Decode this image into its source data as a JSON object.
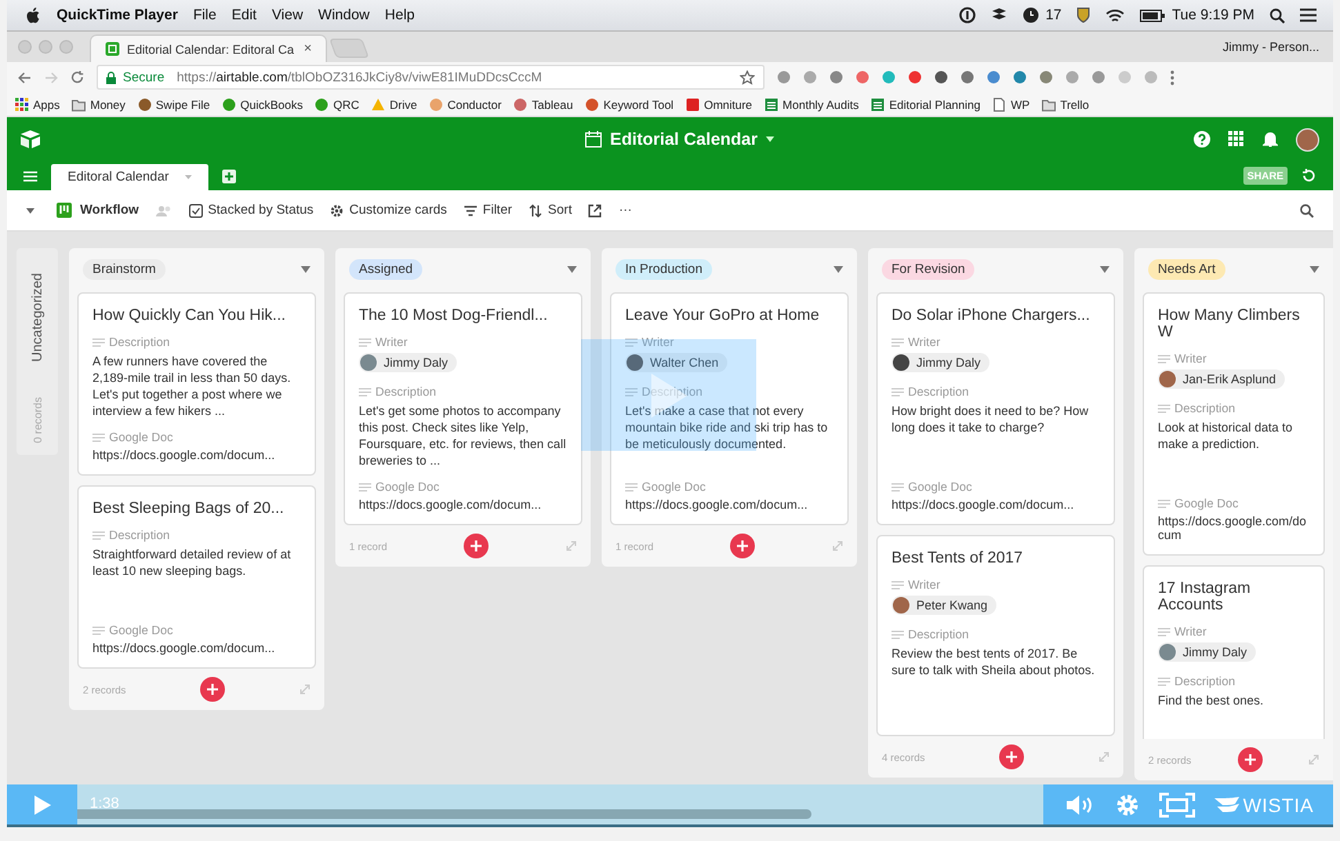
{
  "menubar": {
    "app": "QuickTime Player",
    "menus": [
      "File",
      "Edit",
      "View",
      "Window",
      "Help"
    ],
    "badge": "17",
    "clock": "Tue 9:19 PM"
  },
  "browser": {
    "tab": {
      "title": "Editorial Calendar: Editoral Ca",
      "close": "×"
    },
    "profile": "Jimmy - Person...",
    "secure": "Secure",
    "url": "https://**airtable.com**/tblObOZ316JkCiy8v/viwE81IMuDDcsCccM",
    "bookmarks": [
      "Apps",
      "Money",
      "Swipe File",
      "QuickBooks",
      "QRC",
      "Drive",
      "Conductor",
      "Tableau",
      "Keyword Tool",
      "Omniture",
      "Monthly Audits",
      "Editorial Planning",
      "WP",
      "Trello"
    ]
  },
  "app": {
    "base_title": "Editorial Calendar",
    "tabs": [
      {
        "label": "Editoral Calendar",
        "selected": true
      }
    ],
    "share": "SHARE",
    "view": "Workflow",
    "toolbar": [
      "Stacked by Status",
      "Customize cards",
      "Filter",
      "Sort"
    ],
    "more": "···"
  },
  "uncategorized": {
    "label": "Uncategorized",
    "count": "0 records"
  },
  "columns": [
    {
      "name": "Brainstorm",
      "color": "#ebebeb",
      "count": "2 records",
      "cards": [
        {
          "title": "How Quickly Can You Hik...",
          "fields": [
            {
              "kind": "text",
              "label": "Description",
              "value": "A few runners have covered the 2,189-mile trail in less than 50 days. Let's put together a post where we interview a few hikers ..."
            },
            {
              "kind": "url",
              "label": "Google Doc",
              "value": "https://docs.google.com/docum..."
            }
          ]
        },
        {
          "title": "Best Sleeping Bags of 20...",
          "fields": [
            {
              "kind": "text",
              "label": "Description",
              "value": "Straightforward detailed review of at least 10 new sleeping bags."
            },
            {
              "kind": "url",
              "label": "Google Doc",
              "value": "https://docs.google.com/docum..."
            }
          ]
        }
      ]
    },
    {
      "name": "Assigned",
      "color": "#d3e5fb",
      "count": "1 record",
      "cards": [
        {
          "title": "The 10 Most Dog-Friendl...",
          "fields": [
            {
              "kind": "person",
              "label": "Writer",
              "value": "Jimmy Daly"
            },
            {
              "kind": "text",
              "label": "Description",
              "value": "Let's get some photos to accompany this post. Check sites like Yelp, Foursquare, etc. for reviews, then call breweries to ..."
            },
            {
              "kind": "url",
              "label": "Google Doc",
              "value": "https://docs.google.com/docum..."
            }
          ]
        }
      ]
    },
    {
      "name": "In Production",
      "color": "#d0eefa",
      "count": "1 record",
      "cards": [
        {
          "title": "Leave Your GoPro at Home",
          "fields": [
            {
              "kind": "person",
              "label": "Writer",
              "value": "Walter Chen"
            },
            {
              "kind": "text",
              "label": "Description",
              "value": "Let's make a case that not every mountain bike ride and ski trip has to be meticulously documented."
            },
            {
              "kind": "url",
              "label": "Google Doc",
              "value": "https://docs.google.com/docum..."
            }
          ]
        }
      ]
    },
    {
      "name": "For Revision",
      "color": "#fbd8e2",
      "count": "4 records",
      "cards": [
        {
          "title": "Do Solar iPhone Chargers...",
          "fields": [
            {
              "kind": "person",
              "label": "Writer",
              "value": "Jimmy Daly"
            },
            {
              "kind": "text",
              "label": "Description",
              "value": "How bright does it need to be? How long does it take to charge?"
            },
            {
              "kind": "url",
              "label": "Google Doc",
              "value": "https://docs.google.com/docum..."
            }
          ]
        },
        {
          "title": "Best Tents of 2017",
          "fields": [
            {
              "kind": "person",
              "label": "Writer",
              "value": "Peter Kwang"
            },
            {
              "kind": "text",
              "label": "Description",
              "value": "Review the best tents of 2017. Be sure to talk with Sheila about photos."
            }
          ]
        }
      ]
    },
    {
      "name": "Needs Art",
      "color": "#fde9b2",
      "count": "2 records",
      "cards": [
        {
          "title": "How Many Climbers W",
          "fields": [
            {
              "kind": "person",
              "label": "Writer",
              "value": "Jan-Erik Asplund"
            },
            {
              "kind": "text",
              "label": "Description",
              "value": "Look at historical data to make a prediction."
            },
            {
              "kind": "url",
              "label": "Google Doc",
              "value": "https://docs.google.com/docum"
            }
          ]
        },
        {
          "title": "17 Instagram Accounts",
          "fields": [
            {
              "kind": "person",
              "label": "Writer",
              "value": "Jimmy Daly"
            },
            {
              "kind": "text",
              "label": "Description",
              "value": "Find the best ones."
            }
          ]
        }
      ]
    }
  ],
  "player": {
    "time": "1:38",
    "level": 0.76,
    "brand": "WISTIA"
  }
}
